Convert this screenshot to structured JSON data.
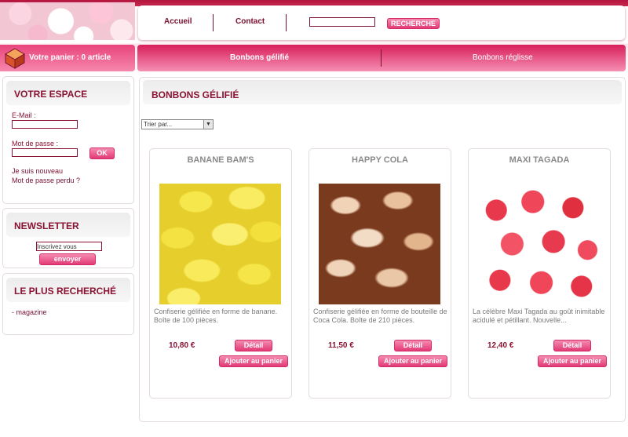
{
  "header": {
    "nav": [
      "Accueil",
      "Contact"
    ],
    "search": {
      "value": "",
      "button_label": "RECHERCHE"
    }
  },
  "cart": {
    "text": "Votre panier : 0 article"
  },
  "categories": [
    "Bonbons gélifié",
    "Bonbons réglisse"
  ],
  "sidebar": {
    "account": {
      "title": "VOTRE ESPACE",
      "email_label": "E-Mail :",
      "password_label": "Mot de passe :",
      "ok_label": "OK",
      "new_user": "Je suis nouveau",
      "lost_password": "Mot de passe perdu ?"
    },
    "newsletter": {
      "title": "NEWSLETTER",
      "input_value": "Inscrivez vous",
      "send_label": "envoyer"
    },
    "popular": {
      "title": "LE PLUS RECHERCHÉ",
      "items": [
        "- magazine"
      ]
    }
  },
  "main": {
    "title": "BONBONS GÉLIFIÉ",
    "sort_value": "Trier par...",
    "products": [
      {
        "name": "BANANE BAM'S",
        "description": "Confiserie gélifiée en forme de banane. Boîte de 100 pièces.",
        "price": "10,80 €",
        "detail_label": "Détail",
        "add_label": "Ajouter au panier"
      },
      {
        "name": "HAPPY COLA",
        "description": "Confiserie gélifiée en forme de bouteille de Coca Cola. Boîte de 210 pièces.",
        "price": "11,50 €",
        "detail_label": "Détail",
        "add_label": "Ajouter au panier"
      },
      {
        "name": "MAXI TAGADA",
        "description": "La célèbre Maxi Tagada au goût inimitable acidulé et pétillant. Nouvelle...",
        "price": "12,40 €",
        "detail_label": "Détail",
        "add_label": "Ajouter au panier"
      }
    ]
  },
  "colors": {
    "accent": "#e23a76",
    "dark": "#7a1030",
    "header_band": "#b3163f"
  }
}
